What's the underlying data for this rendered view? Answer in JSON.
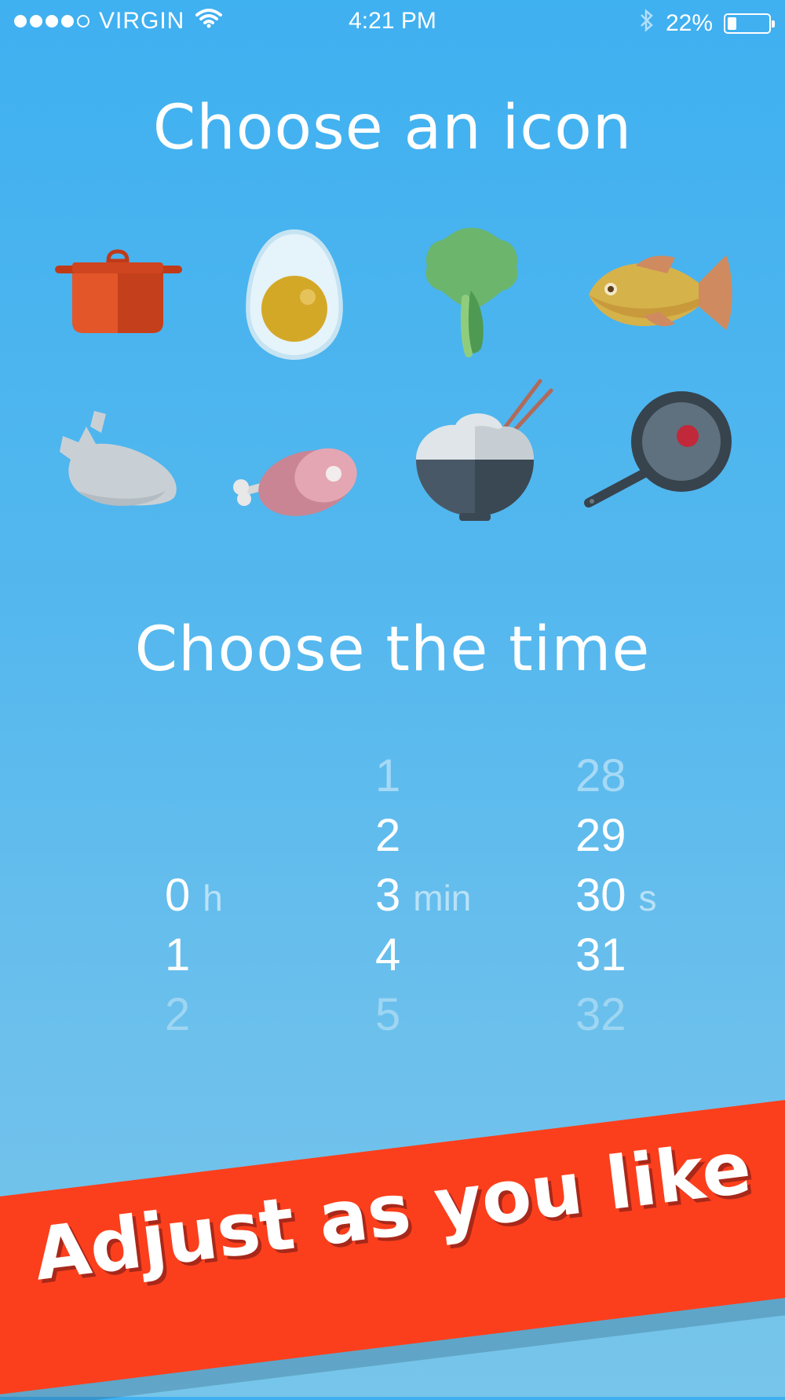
{
  "status_bar": {
    "carrier": "VIRGIN",
    "time": "4:21 PM",
    "battery": "22%",
    "signal_filled": 4,
    "signal_total": 5,
    "battery_level": 0.22
  },
  "icons_section": {
    "title": "Choose an icon",
    "icons": [
      "pot-icon",
      "boiled-egg-icon",
      "lettuce-icon",
      "fish-icon",
      "chicken-icon",
      "ham-icon",
      "rice-bowl-icon",
      "frying-pan-icon"
    ],
    "selected_row": 1
  },
  "time_section": {
    "title": "Choose the time",
    "hours": {
      "values": [
        "",
        "",
        "0",
        "1",
        "2"
      ],
      "unit": "h"
    },
    "minutes": {
      "values": [
        "1",
        "2",
        "3",
        "4",
        "5"
      ],
      "unit": "min"
    },
    "seconds": {
      "values": [
        "28",
        "29",
        "30",
        "31",
        "32"
      ],
      "unit": "s"
    }
  },
  "banner": {
    "text": "Adjust as you like",
    "color": "#fb3f1c"
  }
}
